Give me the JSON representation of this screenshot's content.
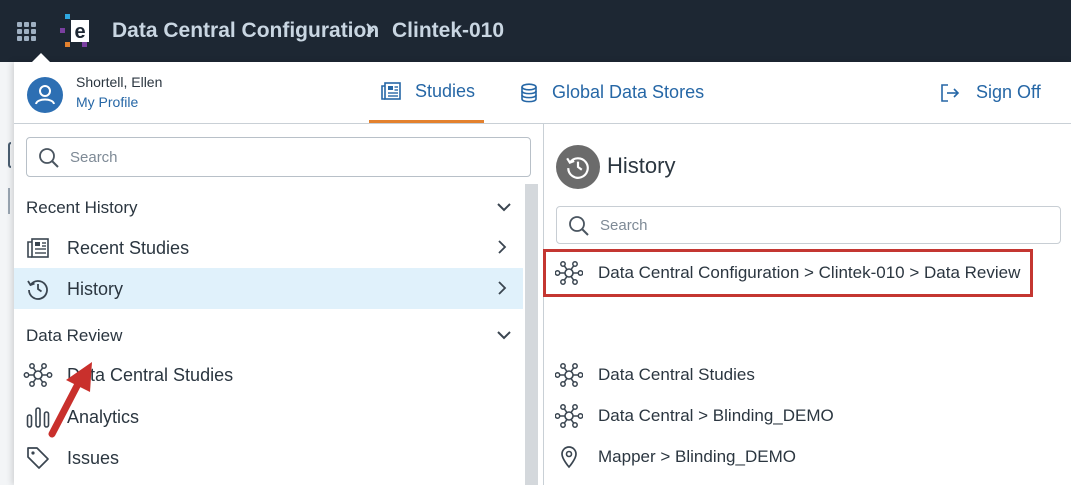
{
  "header": {
    "app_title": "Data Central Configuration",
    "breadcrumb_current": "Clintek-010"
  },
  "user": {
    "name": "Shortell, Ellen",
    "profile_link": "My Profile"
  },
  "tabs": [
    {
      "label": "Studies",
      "icon": "studies-icon",
      "active": true
    },
    {
      "label": "Global Data Stores",
      "icon": "database-icon",
      "active": false
    }
  ],
  "sign_off": {
    "label": "Sign Off",
    "icon": "sign-off-icon"
  },
  "left_search": {
    "placeholder": "Search"
  },
  "sections": {
    "recent_history": "Recent History",
    "data_review": "Data Review"
  },
  "recent_items": [
    {
      "label": "Recent Studies",
      "icon": "newspaper-icon"
    },
    {
      "label": "History",
      "icon": "history-icon",
      "active": true
    }
  ],
  "data_review_items": [
    {
      "label": "Data Central Studies",
      "icon": "network-icon"
    },
    {
      "label": "Analytics",
      "icon": "bar-chart-icon"
    },
    {
      "label": "Issues",
      "icon": "tag-icon"
    }
  ],
  "history_panel": {
    "title": "History",
    "search_placeholder": "Search",
    "items": [
      {
        "label": "Data Central Configuration > Clintek-010 > Data Review",
        "icon": "network-icon",
        "highlighted": true
      },
      {
        "label": "Data Central Studies",
        "icon": "network-icon"
      },
      {
        "label": "Data Central > Blinding_DEMO",
        "icon": "network-icon"
      },
      {
        "label": "Mapper > Blinding_DEMO",
        "icon": "location-pin-icon"
      }
    ]
  },
  "colors": {
    "topbar": "#1d2733",
    "link_blue": "#2667a6",
    "tab_underline": "#e3812e",
    "active_row": "#e0f1fb",
    "highlight_border": "#c43631",
    "annotation_arrow": "#c9302c"
  }
}
